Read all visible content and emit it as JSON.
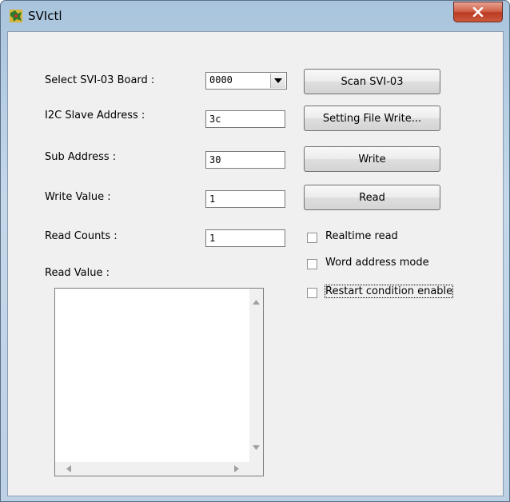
{
  "window": {
    "title": "SVIctl",
    "app_icon": "svictl-app-icon",
    "close_icon": "close-x-icon"
  },
  "form": {
    "select_board_label": "Select SVI-03 Board :",
    "select_board_value": "0000",
    "i2c_label": "I2C Slave Address :",
    "i2c_value": "3c",
    "sub_address_label": "Sub Address :",
    "sub_address_value": "30",
    "write_value_label": "Write Value :",
    "write_value_value": "1",
    "read_counts_label": "Read Counts :",
    "read_counts_value": "1",
    "read_value_label": "Read Value :",
    "read_value_text": ""
  },
  "buttons": {
    "scan": "Scan SVI-03",
    "setting_file_write": "Setting File Write...",
    "write": "Write",
    "read": "Read"
  },
  "checkboxes": {
    "realtime_read": {
      "label": "Realtime read",
      "checked": false
    },
    "word_address_mode": {
      "label": "Word address mode",
      "checked": false
    },
    "restart_condition": {
      "label": "Restart condition enable",
      "checked": false
    }
  },
  "colors": {
    "title_bar": "#bcd1e5",
    "close_button": "#c9462b",
    "client_bg": "#f0f0f0"
  }
}
